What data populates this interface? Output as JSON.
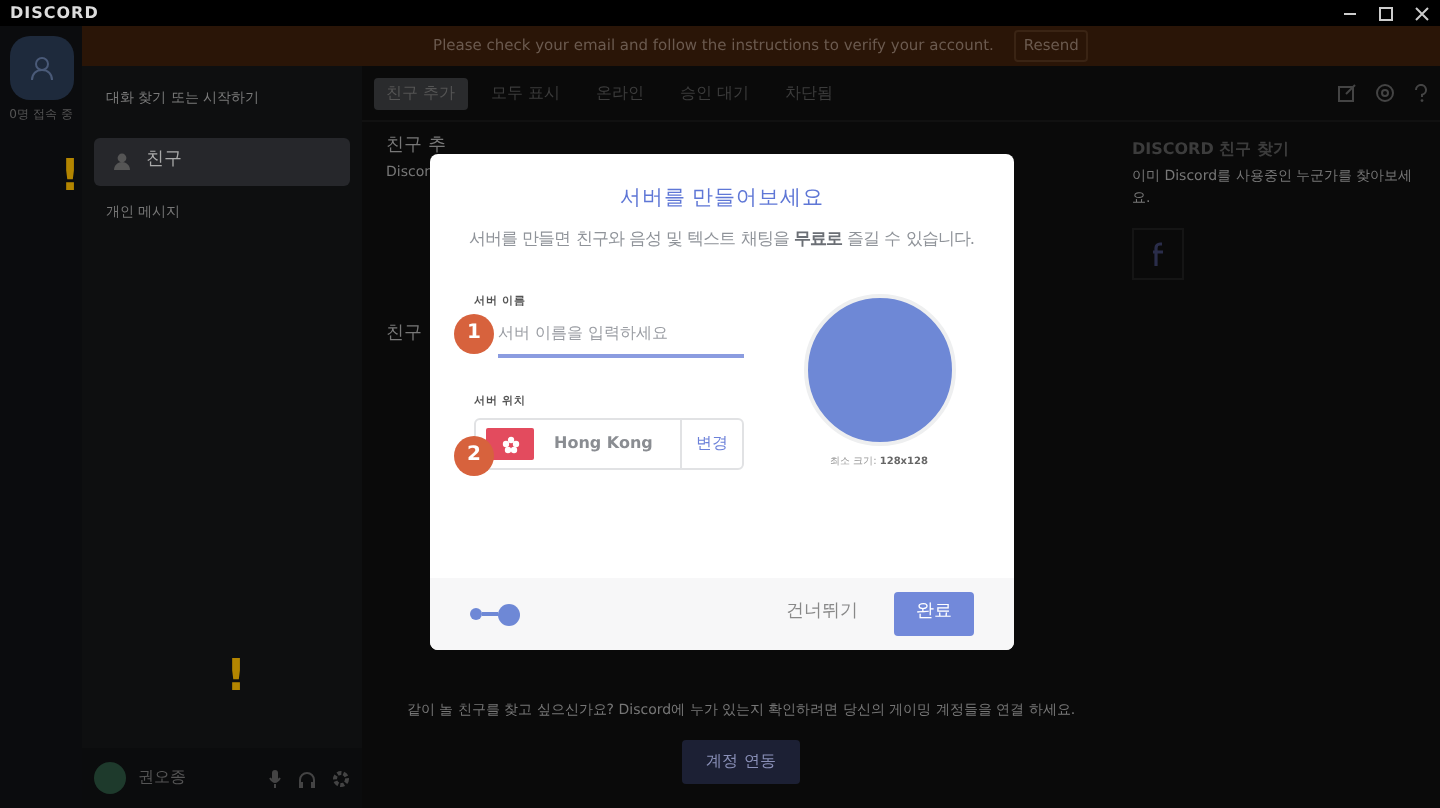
{
  "window": {
    "title": "DISCORD"
  },
  "banner": {
    "message": "Please check your email and follow the instructions to verify your account.",
    "action": "Resend"
  },
  "server_rail": {
    "status": "0명 접속 중"
  },
  "sidebar": {
    "search_placeholder": "대화 찾기 또는 시작하기",
    "items": [
      {
        "label": "친구",
        "selected": true
      }
    ],
    "section": "개인 메시지"
  },
  "user": {
    "name": "권오종"
  },
  "tabs": [
    {
      "label": "친구 추가",
      "selected": true
    },
    {
      "label": "모두 표시",
      "selected": false
    },
    {
      "label": "온라인",
      "selected": false
    },
    {
      "label": "승인 대기",
      "selected": false
    },
    {
      "label": "차단됨",
      "selected": false
    }
  ],
  "main": {
    "heading": "친구 추",
    "subtext": "Discor",
    "heading_2": "친구 ",
    "connect_text": "같이 놀 친구를 찾고 싶으신가요? Discord에 누가 있는지 확인하려면 당신의 게이밍 계정들을 연결 하세요.",
    "connect_button": "계정 연동"
  },
  "find_friends": {
    "title": "DISCORD 친구 찾기",
    "text": "이미 Discord를 사용중인 누군가를 찾아보세요."
  },
  "warning_marks": [
    "!",
    "!"
  ],
  "modal": {
    "title": "서버를 만들어보세요",
    "description": "서버를 만들면 친구와 음성 및 텍스트 채팅을 **무료로** 즐길 수 있습니다.",
    "name_label": "서버 이름",
    "name_placeholder": "서버 이름을 입력하세요",
    "name_step": "1",
    "region_label": "서버 위치",
    "region": "Hong Kong",
    "region_step": "2",
    "change": "변경",
    "icon_hint": "최소 크기: **128x128**",
    "progress": [
      {
        "selected": false
      },
      {
        "selected": true
      }
    ],
    "skip": "건너뛰기",
    "done": "완료"
  }
}
